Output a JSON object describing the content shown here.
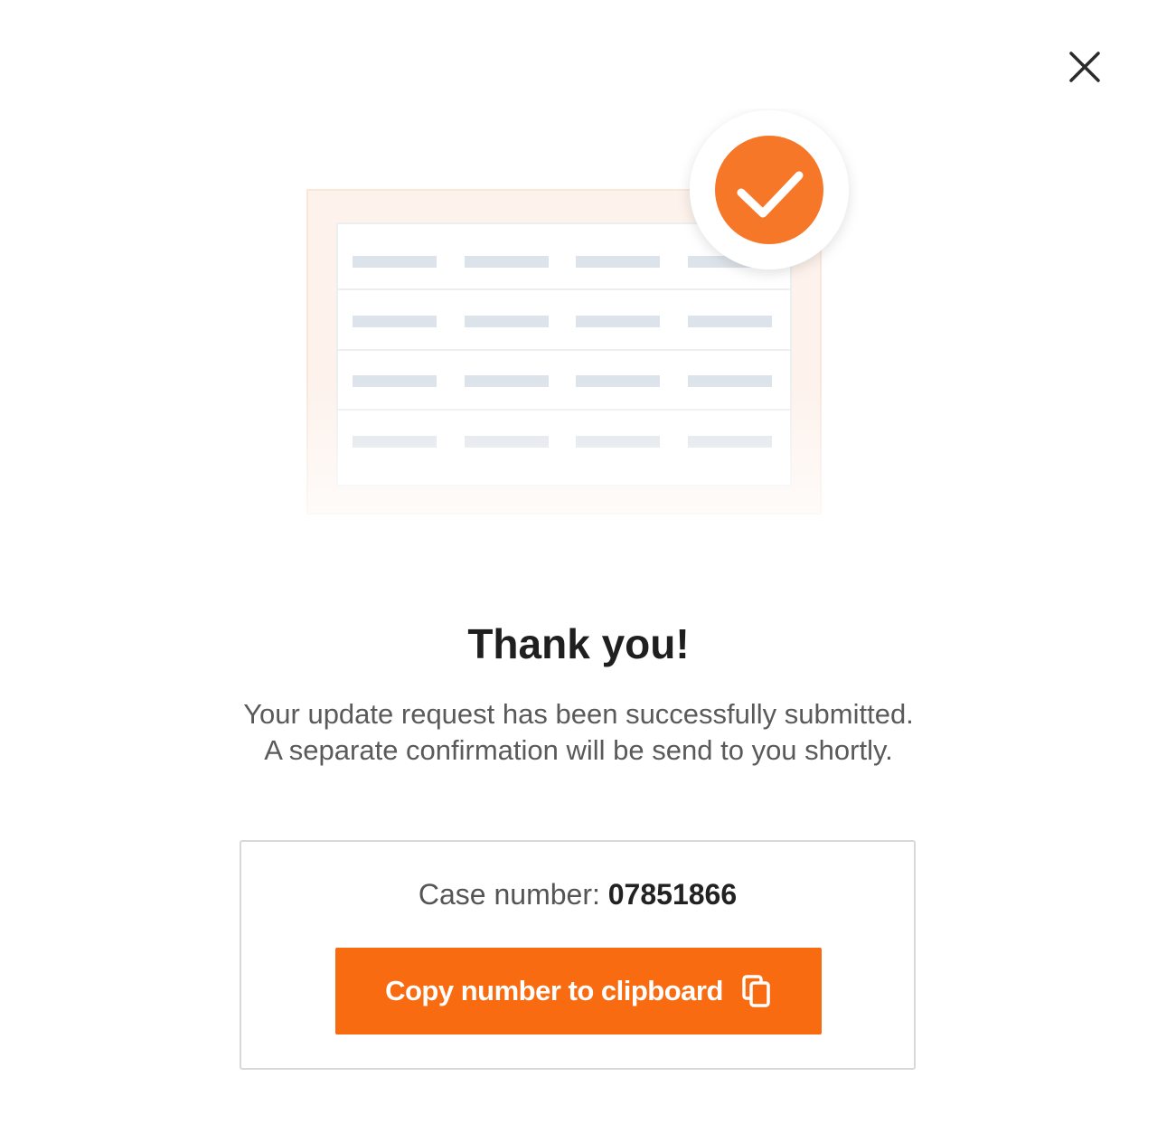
{
  "dialog": {
    "close_label": "Close"
  },
  "title": "Thank you!",
  "message": {
    "line1": "Your update request has been successfully submitted.",
    "line2": "A separate confirmation will be send to you shortly."
  },
  "case": {
    "label": "Case number: ",
    "number": "07851866"
  },
  "copy_button": {
    "label": "Copy number to clipboard",
    "icon": "copy-icon"
  },
  "colors": {
    "accent": "#f96b10",
    "title": "#1f1f1f",
    "text": "#5a5a5a"
  },
  "icons": {
    "close": "close-icon",
    "success": "checkmark-icon"
  }
}
